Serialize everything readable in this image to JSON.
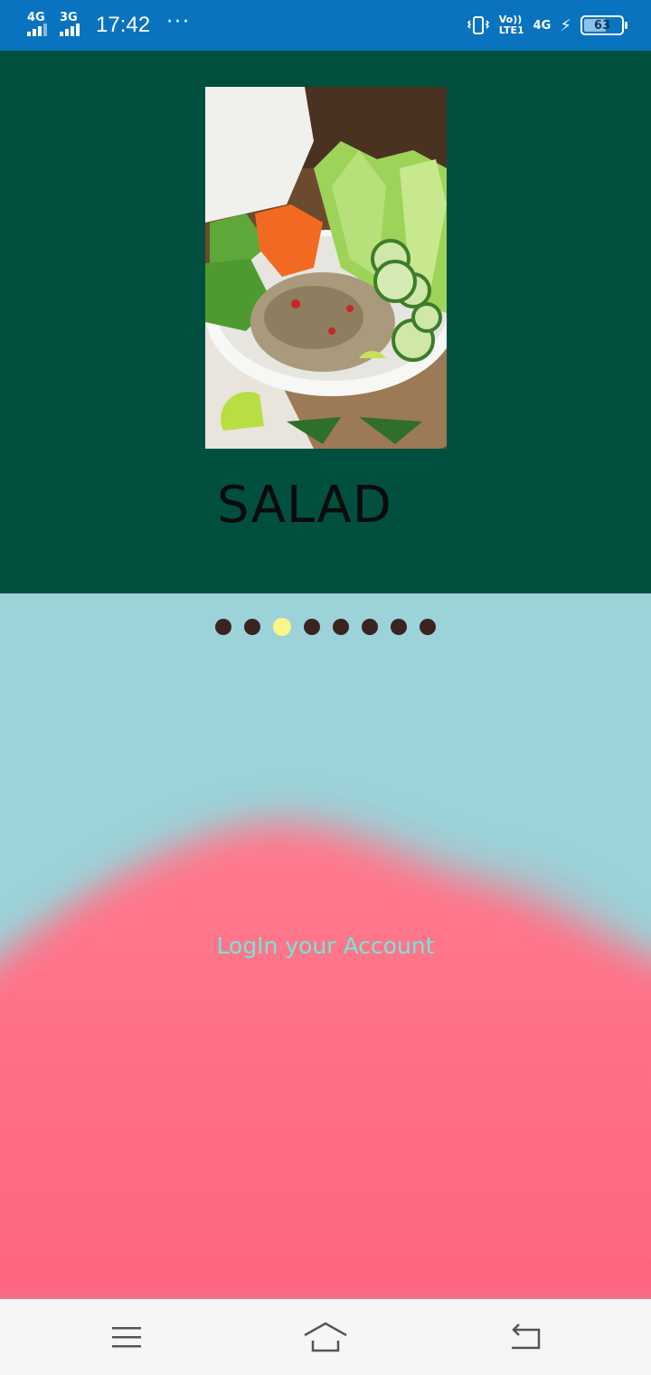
{
  "status_bar": {
    "network_1": "4G",
    "network_2": "3G",
    "time": "17:42",
    "more": "···",
    "volte_line1": "Vo))",
    "volte_line2": "LTE1",
    "network_3": "4G",
    "battery_level": "63",
    "battery_percent": 63
  },
  "hero": {
    "image_icon": "salad-bowl-photo",
    "title": "SALAD"
  },
  "pager": {
    "count": 8,
    "active_index": 2
  },
  "login": {
    "label": "LogIn your Account"
  },
  "nav_bar": {
    "menu_icon": "menu-icon",
    "home_icon": "home-icon",
    "back_icon": "back-icon"
  },
  "colors": {
    "status_bar": "#0a73bf",
    "hero_bg": "#004f3f",
    "sky": "#9bd3d9",
    "pink": "#ff6b82",
    "dot": "#3b2320",
    "dot_active": "#fcf58a",
    "login_text": "#74e7d8"
  }
}
